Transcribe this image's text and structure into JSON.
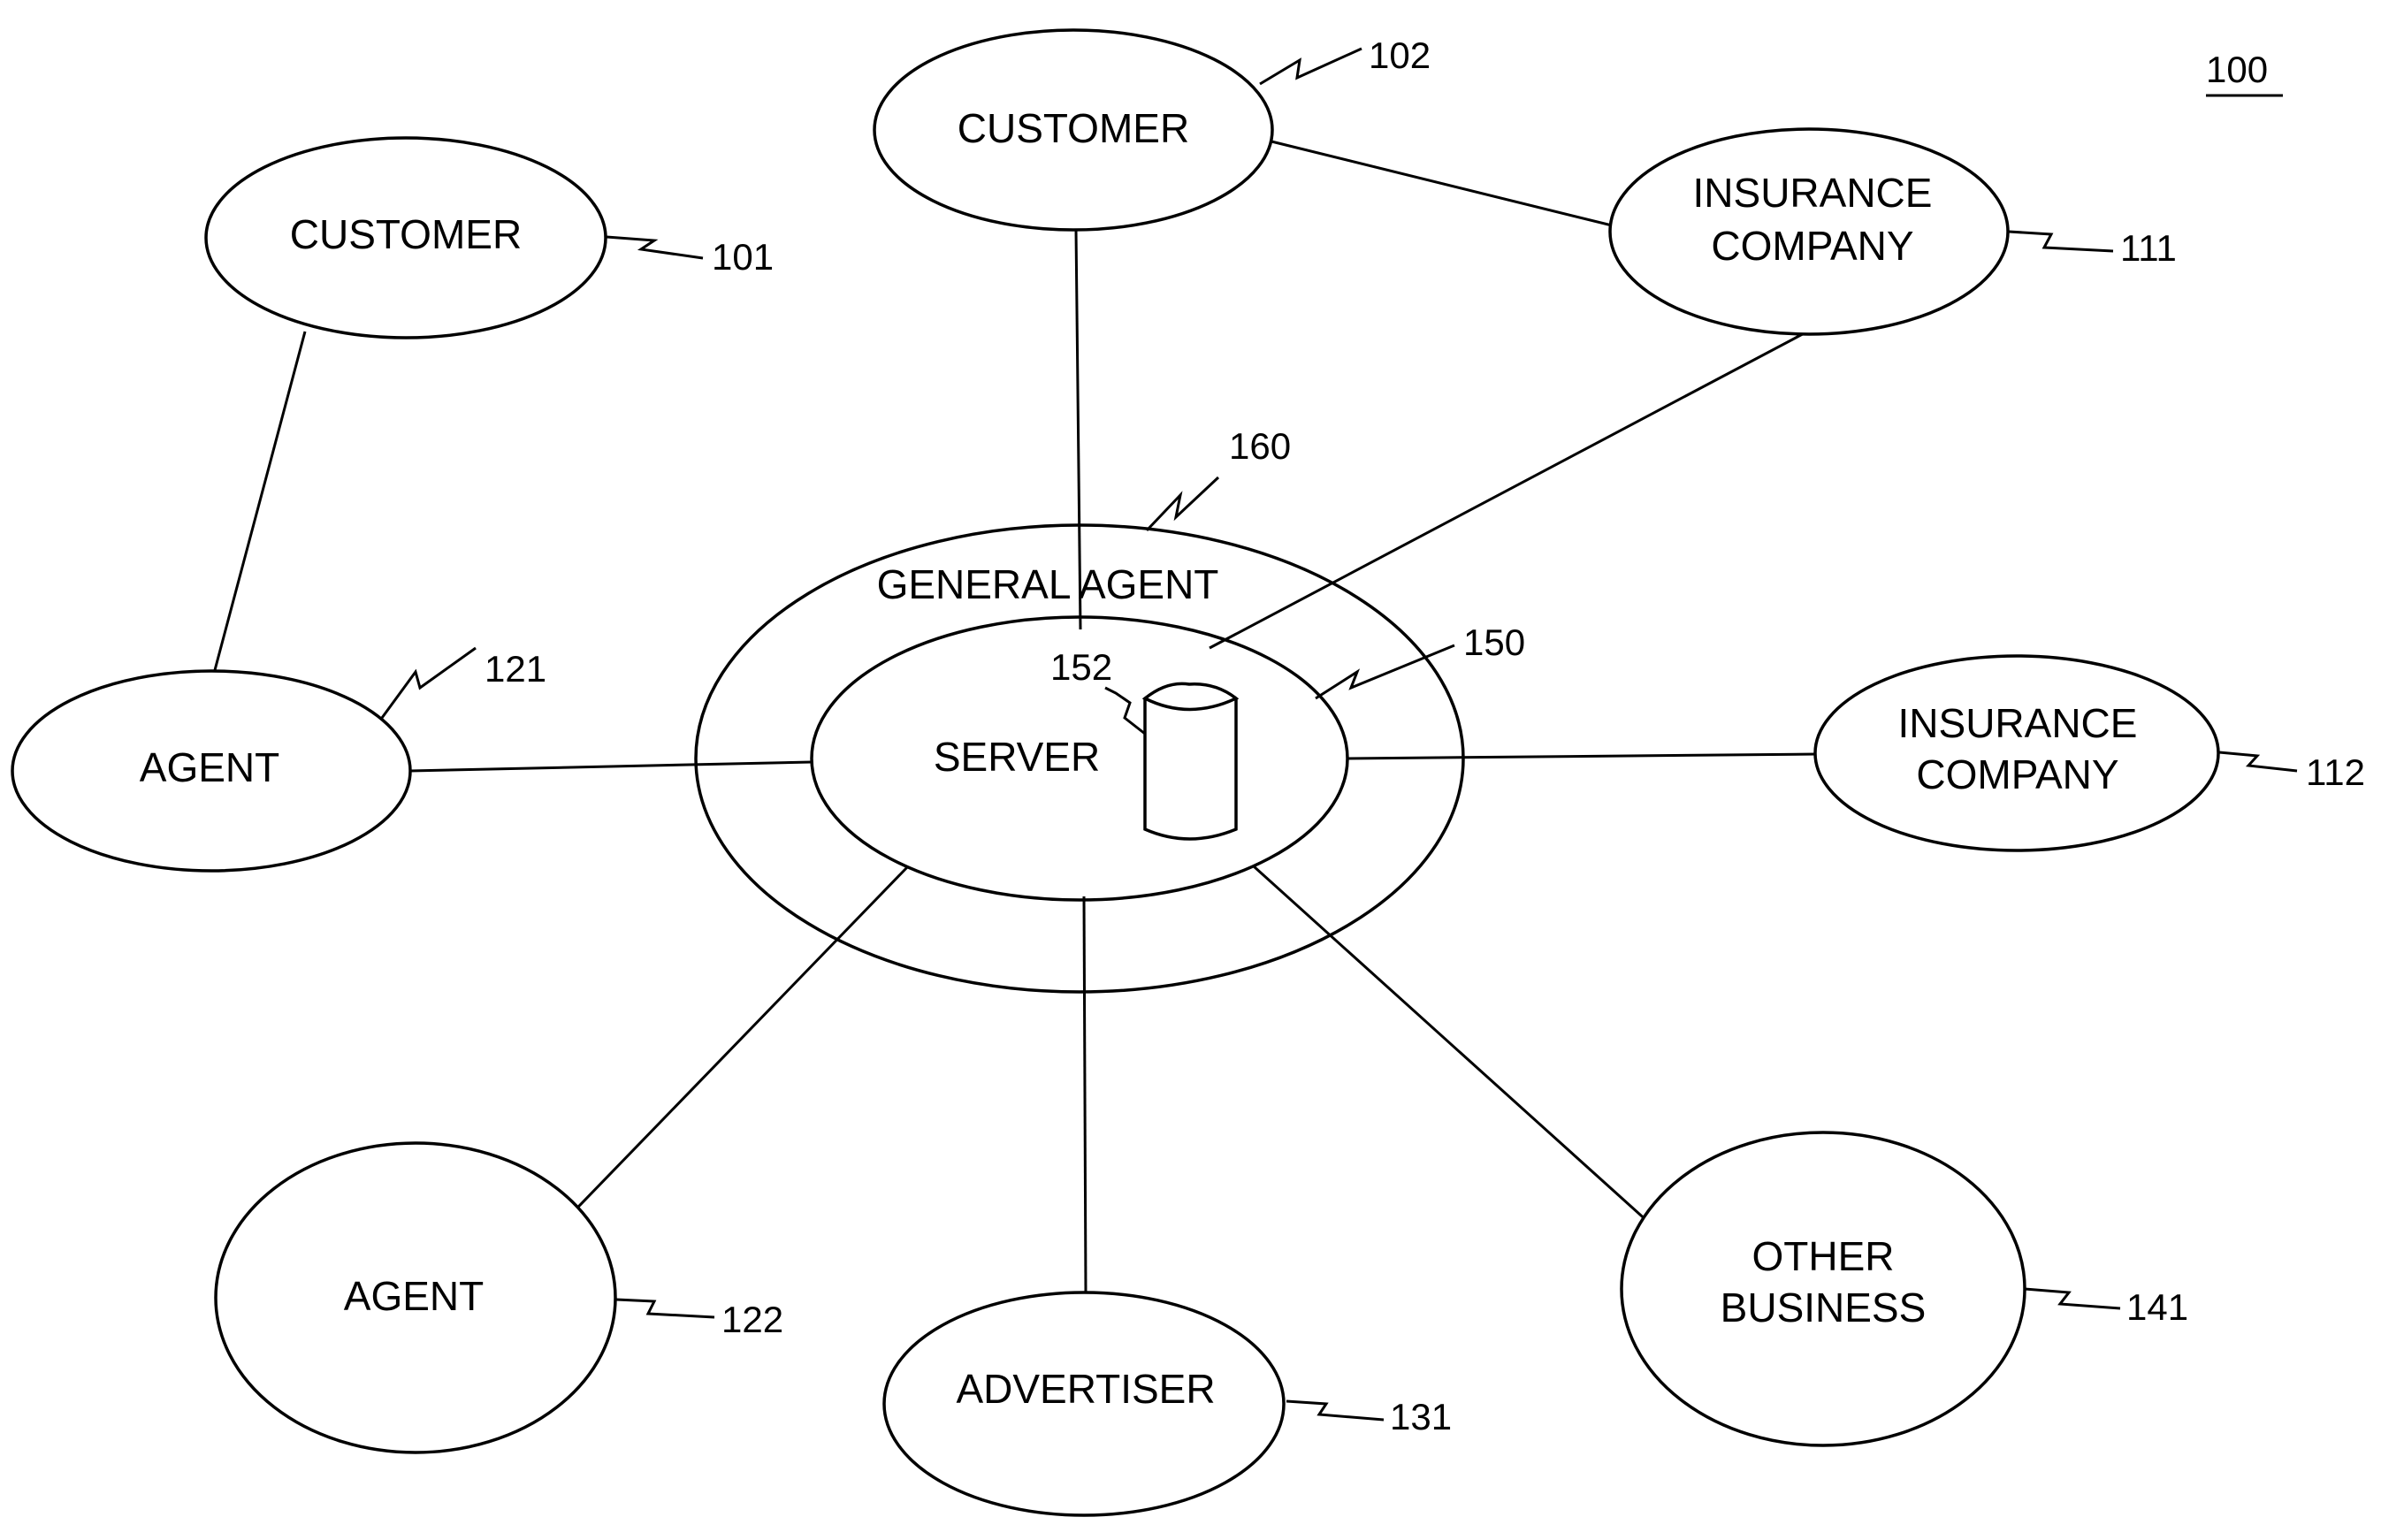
{
  "figure": {
    "reference": "100",
    "central": {
      "general_agent": {
        "label": "GENERAL AGENT",
        "ref": "160"
      },
      "server": {
        "label": "SERVER",
        "ref": "150"
      },
      "database": {
        "ref": "152"
      }
    },
    "nodes": [
      {
        "id": "customer-101",
        "lines": [
          "CUSTOMER"
        ],
        "ref": "101"
      },
      {
        "id": "customer-102",
        "lines": [
          "CUSTOMER"
        ],
        "ref": "102"
      },
      {
        "id": "insurance-111",
        "lines": [
          "INSURANCE",
          "COMPANY"
        ],
        "ref": "111"
      },
      {
        "id": "insurance-112",
        "lines": [
          "INSURANCE",
          "COMPANY"
        ],
        "ref": "112"
      },
      {
        "id": "agent-121",
        "lines": [
          "AGENT"
        ],
        "ref": "121"
      },
      {
        "id": "agent-122",
        "lines": [
          "AGENT"
        ],
        "ref": "122"
      },
      {
        "id": "advertiser-131",
        "lines": [
          "ADVERTISER"
        ],
        "ref": "131"
      },
      {
        "id": "other-141",
        "lines": [
          "OTHER",
          "BUSINESS"
        ],
        "ref": "141"
      }
    ],
    "connections": [
      [
        "customer-101",
        "agent-121"
      ],
      [
        "customer-102",
        "insurance-111"
      ],
      [
        "customer-102",
        "server"
      ],
      [
        "insurance-111",
        "server"
      ],
      [
        "agent-121",
        "server"
      ],
      [
        "insurance-112",
        "server"
      ],
      [
        "agent-122",
        "server"
      ],
      [
        "advertiser-131",
        "server"
      ],
      [
        "other-141",
        "server"
      ]
    ]
  }
}
